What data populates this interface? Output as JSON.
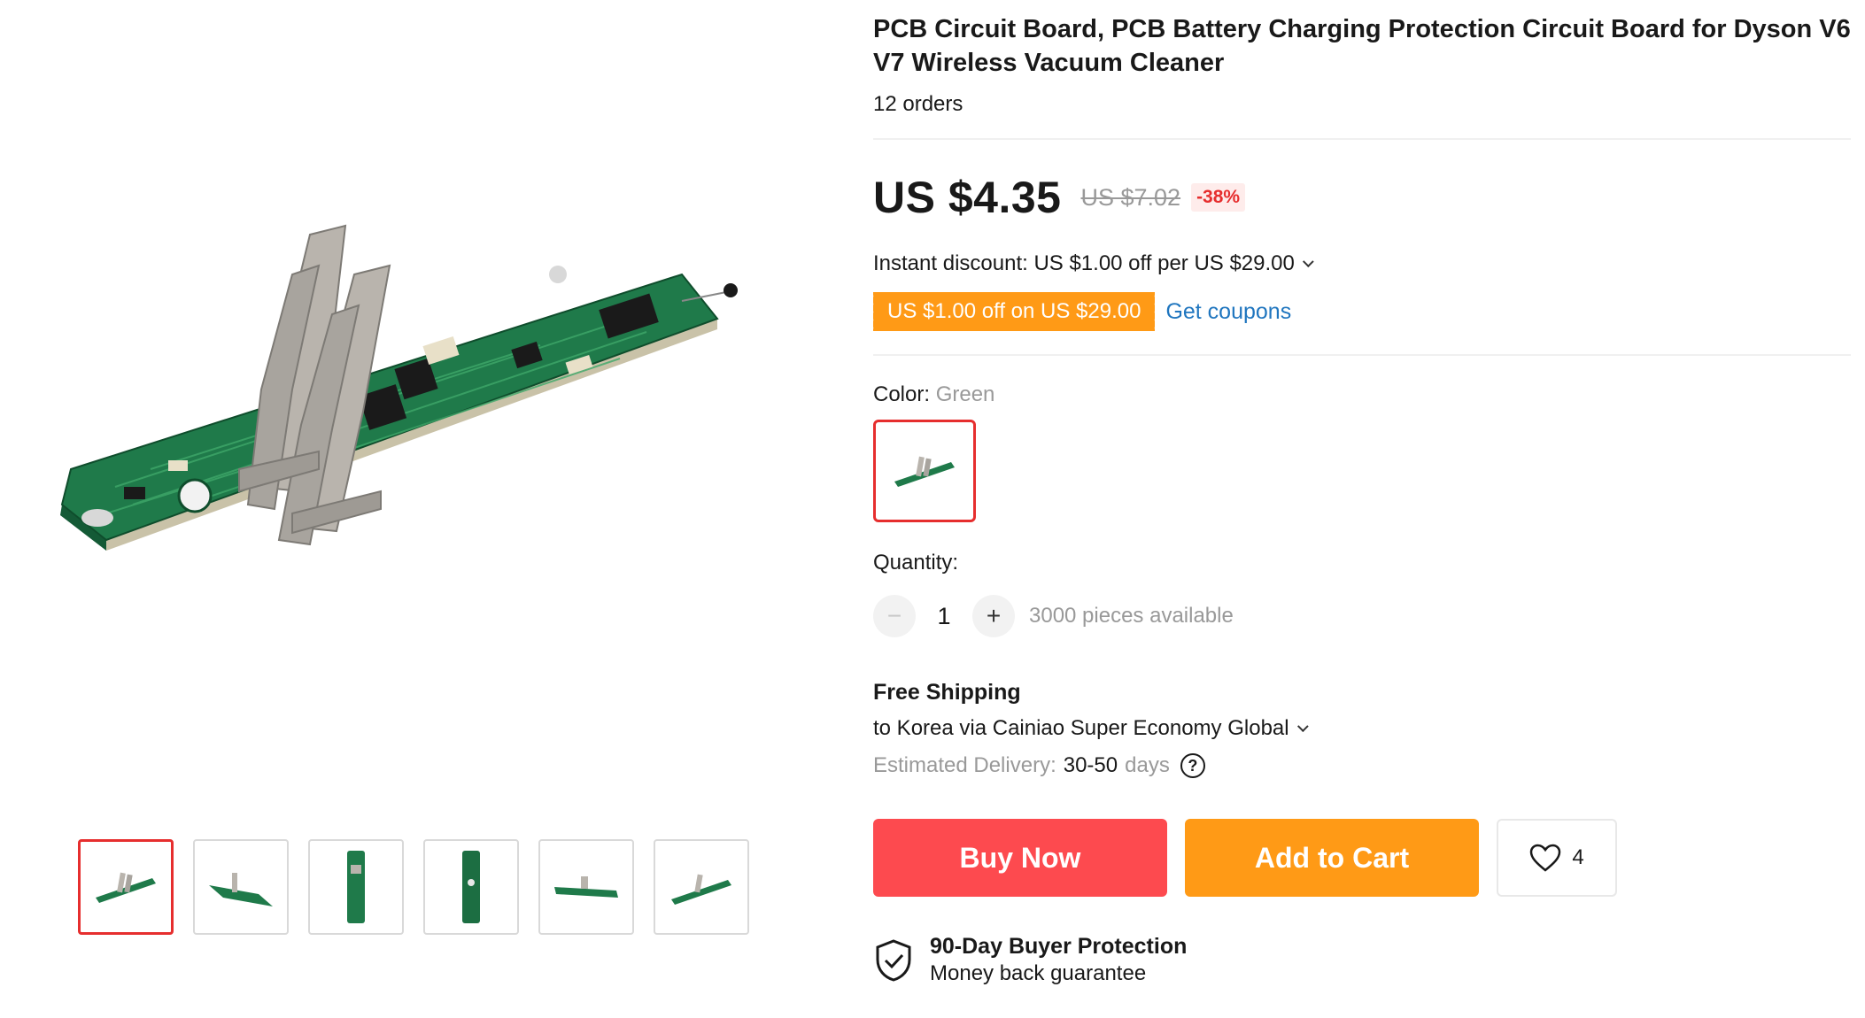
{
  "product": {
    "title": "PCB Circuit Board, PCB Battery Charging Protection Circuit Board for Dyson V6 V7 Wireless Vacuum Cleaner",
    "orders": "12 orders"
  },
  "price": {
    "current": "US $4.35",
    "original": "US $7.02",
    "discount": "-38%"
  },
  "promo": {
    "instant_discount": "Instant discount: US $1.00 off per US $29.00",
    "coupon_label": "US $1.00 off on US $29.00",
    "get_coupons": "Get coupons"
  },
  "color": {
    "label": "Color:",
    "selected": "Green"
  },
  "quantity": {
    "label": "Quantity:",
    "value": "1",
    "minus_symbol": "−",
    "plus_symbol": "+",
    "stock": "3000 pieces available"
  },
  "shipping": {
    "title": "Free Shipping",
    "route": "to Korea via Cainiao Super Economy Global",
    "estimated_label": "Estimated Delivery:",
    "estimated_value": "30-50",
    "estimated_unit": "days",
    "help_symbol": "?"
  },
  "actions": {
    "buy_now": "Buy Now",
    "add_to_cart": "Add to Cart",
    "wishlist_count": "4"
  },
  "protection": {
    "title": "90-Day Buyer Protection",
    "subtitle": "Money back guarantee"
  },
  "gallery": {
    "thumbnails": [
      "angle-view",
      "angle-view",
      "top-view",
      "top-view",
      "side-view",
      "angle-view"
    ],
    "active_index": 0
  },
  "colors": {
    "accent_red": "#e62e2e",
    "buy_button": "#fd4a4f",
    "cart_button": "#ff9a16",
    "link_blue": "#2076bf",
    "pcb_green": "#2e8b57"
  }
}
